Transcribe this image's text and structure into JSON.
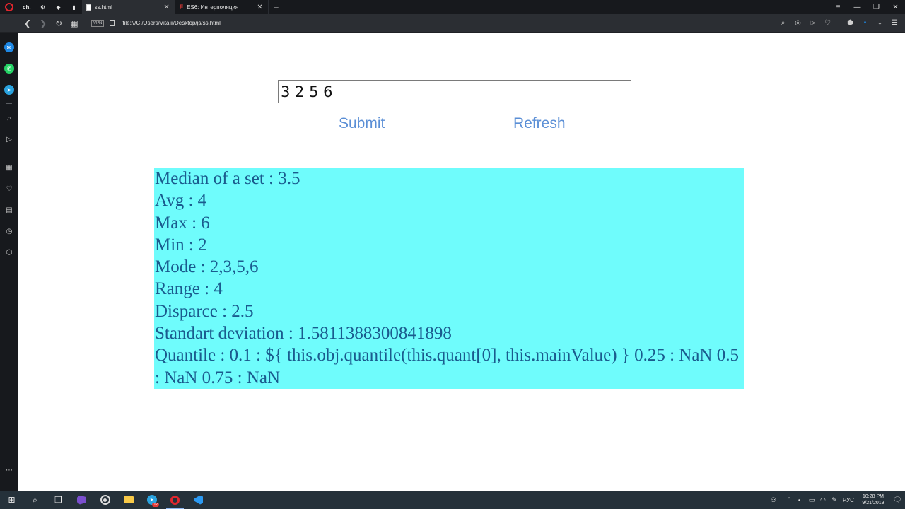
{
  "browser": {
    "pinned_tab_label": "ch.",
    "tabs": [
      {
        "title": "ss.html",
        "active": true
      },
      {
        "title": "ES6: Интерполяция",
        "active": false
      }
    ],
    "url": "file:///C:/Users/Vitalii/Desktop/js/ss.html",
    "vpn_label": "VPN"
  },
  "page": {
    "input_value": "3 2 5 6",
    "submit_label": "Submit",
    "refresh_label": "Refresh",
    "results": {
      "median": "Median of a set : 3.5",
      "avg": "Avg : 4",
      "max": "Max : 6",
      "min": "Min : 2",
      "mode": "Mode : 2,3,5,6",
      "range": "Range : 4",
      "disparce": "Disparce : 2.5",
      "std": "Standart deviation : 1.5811388300841898",
      "quantile": "Quantile : 0.1 : ${ this.obj.quantile(this.quant[0], this.mainValue) } 0.25 : NaN 0.5 : NaN 0.75 : NaN"
    },
    "result_bg": "#6ffcfc",
    "result_text_color": "#1a5b8e",
    "link_color": "#5b8fd6"
  },
  "taskbar": {
    "language": "РУС",
    "time": "10:28 PM",
    "date": "9/21/2019",
    "telegram_badge": "12"
  }
}
